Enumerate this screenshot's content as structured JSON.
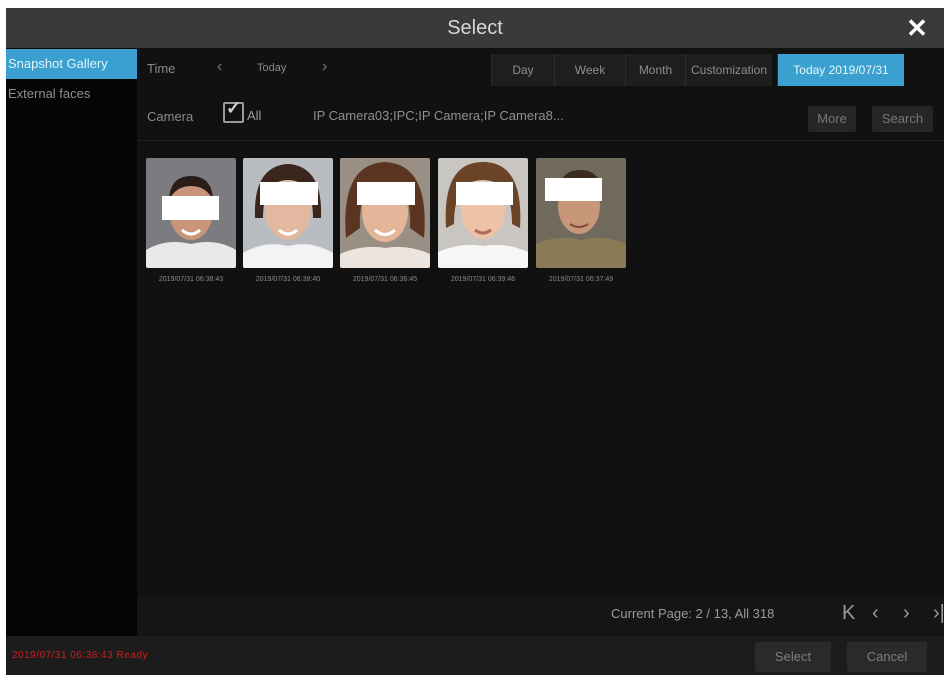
{
  "dialog": {
    "title": "Select"
  },
  "sidebar": {
    "items": [
      {
        "label": "Snapshot Gallery",
        "active": true
      },
      {
        "label": "External faces",
        "active": false
      }
    ]
  },
  "time_bar": {
    "label": "Time",
    "current": "Today",
    "segments": [
      "Day",
      "Week",
      "Month",
      "Customization",
      "Today 2019/07/31"
    ],
    "active_segment": "Today 2019/07/31"
  },
  "camera_bar": {
    "label": "Camera",
    "all_checked": true,
    "all_label": "All",
    "cameras_text": "IP Camera03;IPC;IP Camera;IP Camera8...",
    "more_label": "More",
    "search_label": "Search"
  },
  "gallery": {
    "captions": [
      "2019/07/31 06:38:43",
      "2019/07/31 06:38:40",
      "2019/07/31 06:36:45",
      "2019/07/31 06:39:46",
      "2019/07/31 06:37:49"
    ]
  },
  "pager": {
    "text": "Current Page: 2 / 13, All 318",
    "icons": [
      "first-page-icon",
      "prev-page-icon",
      "next-page-icon",
      "last-page-icon"
    ]
  },
  "footer": {
    "status": "2019/07/31 06:38:43 Ready",
    "select_label": "Select",
    "cancel_label": "Cancel"
  },
  "colors": {
    "accent": "#3aa0cf",
    "background": "#0c0c0c",
    "status": "#cc2020"
  }
}
